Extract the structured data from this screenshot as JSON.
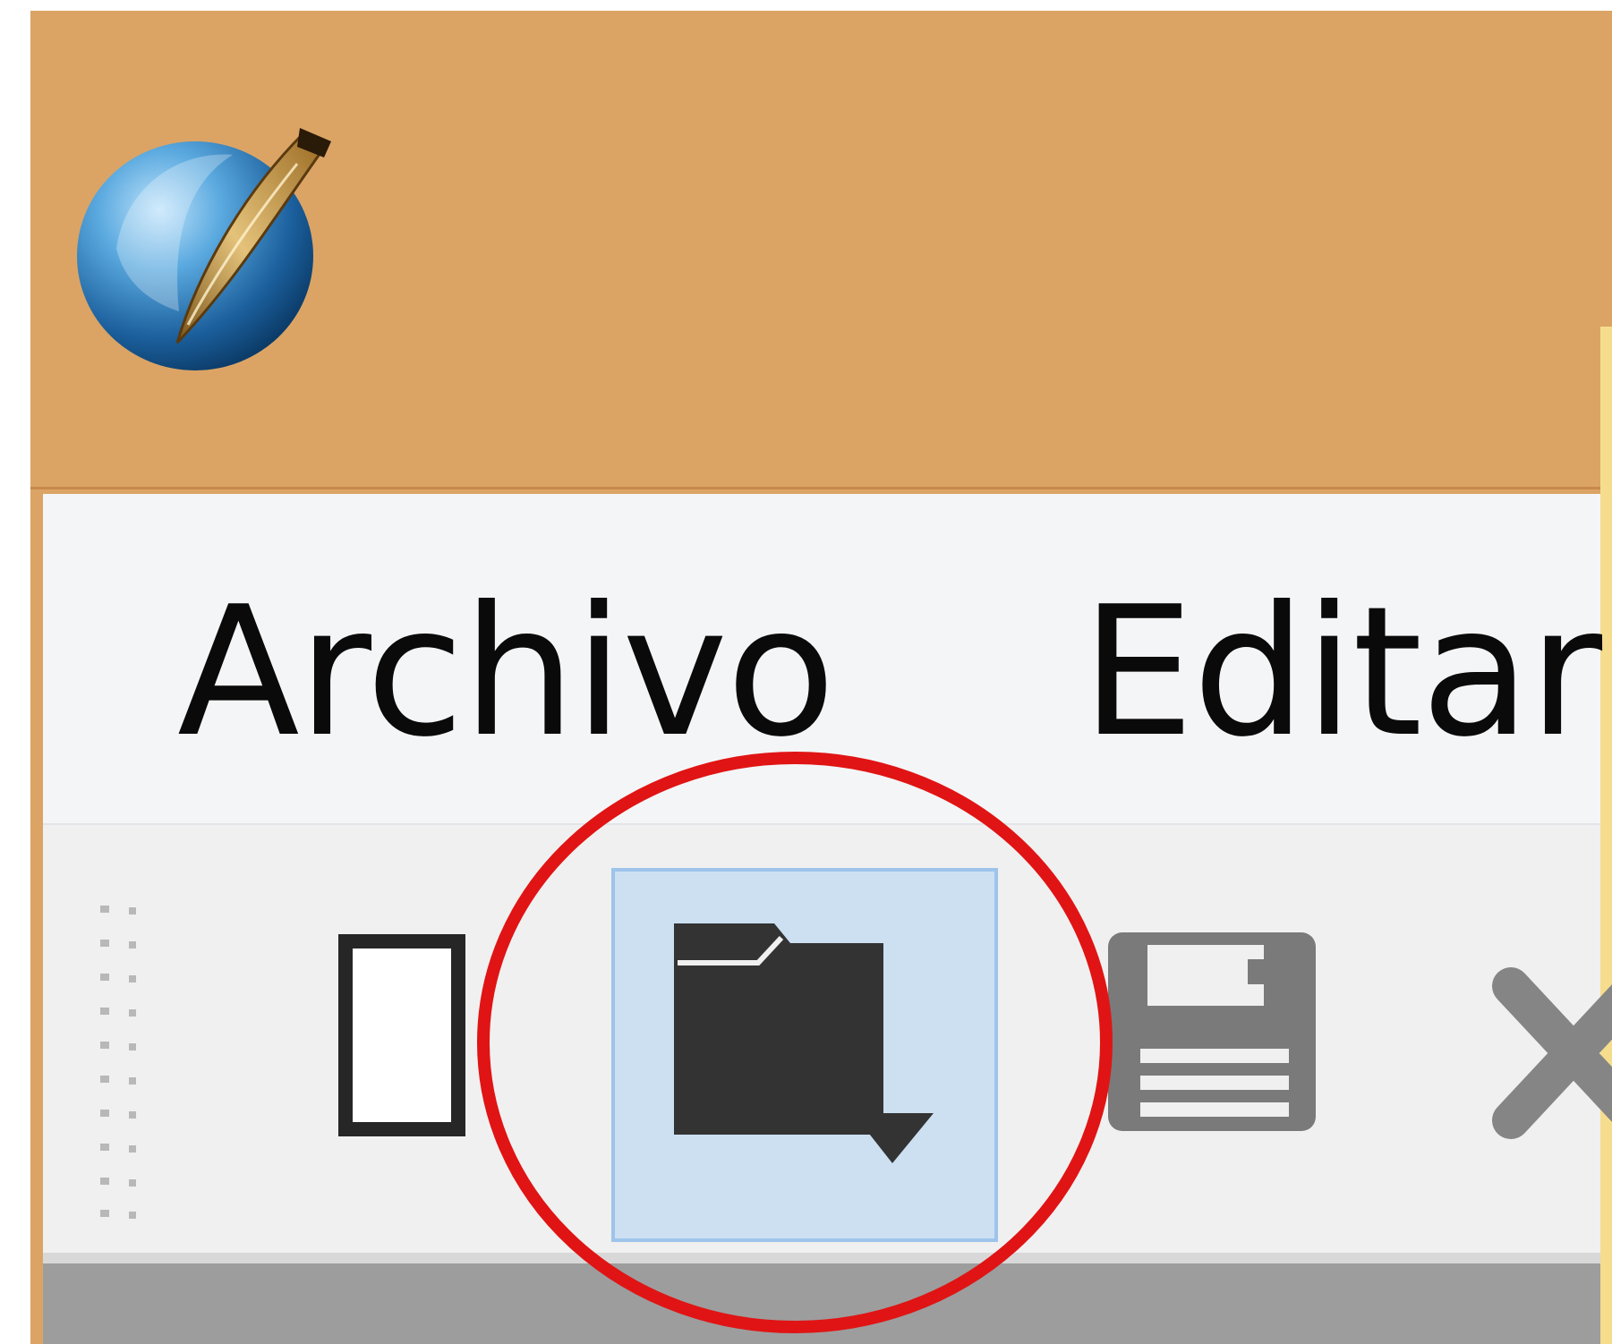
{
  "window": {
    "app_icon": "quill-pen-globe-icon",
    "colors": {
      "title_bar": "#dba465",
      "menu_bar": "#f4f5f7",
      "toolbar": "#f0f0f0",
      "highlight": "#cde0f2",
      "annotation": "#e01414"
    }
  },
  "menu": {
    "items": [
      {
        "label": "Archivo"
      },
      {
        "label": "Editar"
      }
    ]
  },
  "toolbar": {
    "buttons": [
      {
        "icon": "new-document-icon"
      },
      {
        "icon": "open-folder-icon",
        "state": "hovered"
      },
      {
        "icon": "save-disk-icon"
      },
      {
        "icon": "close-x-icon"
      }
    ]
  },
  "annotation": {
    "shape": "circle",
    "target": "open-folder-button"
  }
}
